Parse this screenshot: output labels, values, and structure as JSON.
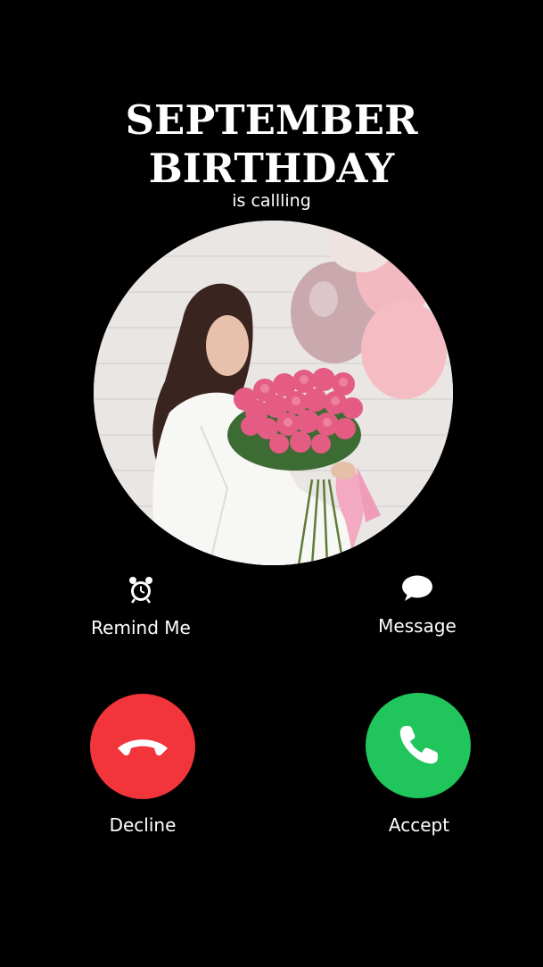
{
  "caller": {
    "line1": "SEPTEMBER",
    "line2": "BIRTHDAY",
    "status": "is callling"
  },
  "actions": {
    "remind_label": "Remind Me",
    "message_label": "Message"
  },
  "buttons": {
    "decline_label": "Decline",
    "accept_label": "Accept"
  },
  "colors": {
    "background": "#000000",
    "decline": "#f2343b",
    "accept": "#20c55c",
    "text": "#ffffff"
  },
  "icons": {
    "remind": "alarm-clock-icon",
    "message": "speech-bubble-icon",
    "decline": "phone-hangup-icon",
    "accept": "phone-icon"
  }
}
